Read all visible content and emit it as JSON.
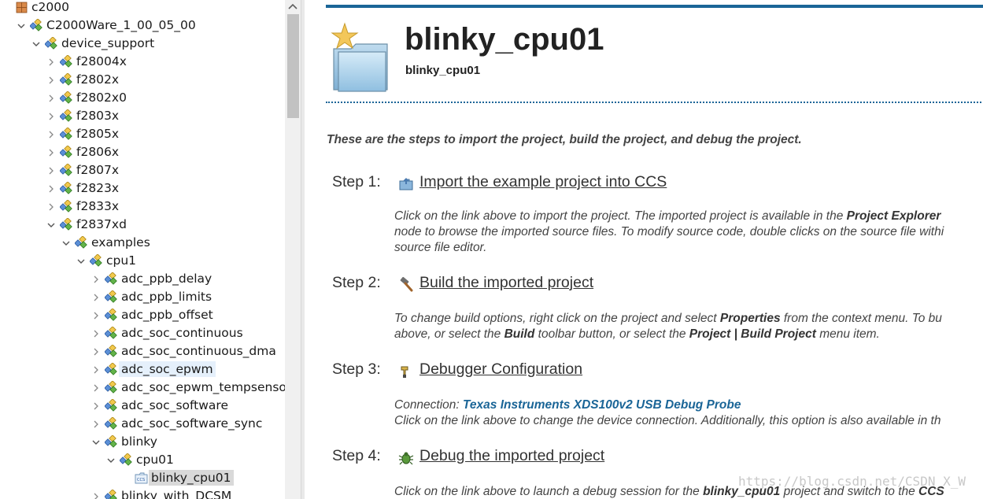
{
  "tree": {
    "items": [
      {
        "label": "c2000",
        "depth": 0,
        "expanded": null,
        "icon": "project-root-icon"
      },
      {
        "label": "C2000Ware_1_00_05_00",
        "depth": 1,
        "expanded": true,
        "icon": "package-icon"
      },
      {
        "label": "device_support",
        "depth": 2,
        "expanded": true,
        "icon": "package-icon"
      },
      {
        "label": "f28004x",
        "depth": 3,
        "expanded": false,
        "icon": "package-icon"
      },
      {
        "label": "f2802x",
        "depth": 3,
        "expanded": false,
        "icon": "package-icon"
      },
      {
        "label": "f2802x0",
        "depth": 3,
        "expanded": false,
        "icon": "package-icon"
      },
      {
        "label": "f2803x",
        "depth": 3,
        "expanded": false,
        "icon": "package-icon"
      },
      {
        "label": "f2805x",
        "depth": 3,
        "expanded": false,
        "icon": "package-icon"
      },
      {
        "label": "f2806x",
        "depth": 3,
        "expanded": false,
        "icon": "package-icon"
      },
      {
        "label": "f2807x",
        "depth": 3,
        "expanded": false,
        "icon": "package-icon"
      },
      {
        "label": "f2823x",
        "depth": 3,
        "expanded": false,
        "icon": "package-icon"
      },
      {
        "label": "f2833x",
        "depth": 3,
        "expanded": false,
        "icon": "package-icon"
      },
      {
        "label": "f2837xd",
        "depth": 3,
        "expanded": true,
        "icon": "package-icon"
      },
      {
        "label": "examples",
        "depth": 4,
        "expanded": true,
        "icon": "package-icon"
      },
      {
        "label": "cpu1",
        "depth": 5,
        "expanded": true,
        "icon": "package-icon"
      },
      {
        "label": "adc_ppb_delay",
        "depth": 6,
        "expanded": false,
        "icon": "package-icon"
      },
      {
        "label": "adc_ppb_limits",
        "depth": 6,
        "expanded": false,
        "icon": "package-icon"
      },
      {
        "label": "adc_ppb_offset",
        "depth": 6,
        "expanded": false,
        "icon": "package-icon"
      },
      {
        "label": "adc_soc_continuous",
        "depth": 6,
        "expanded": false,
        "icon": "package-icon"
      },
      {
        "label": "adc_soc_continuous_dma",
        "depth": 6,
        "expanded": false,
        "icon": "package-icon"
      },
      {
        "label": "adc_soc_epwm",
        "depth": 6,
        "expanded": false,
        "icon": "package-icon",
        "highlight": "soft"
      },
      {
        "label": "adc_soc_epwm_tempsensor",
        "depth": 6,
        "expanded": false,
        "icon": "package-icon"
      },
      {
        "label": "adc_soc_software",
        "depth": 6,
        "expanded": false,
        "icon": "package-icon"
      },
      {
        "label": "adc_soc_software_sync",
        "depth": 6,
        "expanded": false,
        "icon": "package-icon"
      },
      {
        "label": "blinky",
        "depth": 6,
        "expanded": true,
        "icon": "package-icon"
      },
      {
        "label": "cpu01",
        "depth": 7,
        "expanded": true,
        "icon": "package-icon"
      },
      {
        "label": "blinky_cpu01",
        "depth": 8,
        "expanded": null,
        "icon": "ccs-project-icon",
        "highlight": "hard"
      },
      {
        "label": "blinky_with_DCSM",
        "depth": 6,
        "expanded": false,
        "icon": "package-icon"
      }
    ]
  },
  "header": {
    "title": "blinky_cpu01",
    "subtitle": "blinky_cpu01"
  },
  "intro": "These are the steps to import the project, build the project, and debug the project.",
  "steps": [
    {
      "label": "Step 1:",
      "link": "Import the example project into CCS",
      "icon": "import-project-icon",
      "desc": {
        "l1a": "Click on the link above to import the project. The imported project is available in the ",
        "l1b": "Project Explorer",
        "l2": "node to browse the imported source files. To modify source code, double clicks on the source file withi",
        "l3": "source file editor."
      }
    },
    {
      "label": "Step 2:",
      "link": "Build the imported project",
      "icon": "hammer-icon",
      "desc": {
        "l1a": "To change build options, right click on the project and select ",
        "l1b": "Properties",
        "l1c": " from the context menu. To bu",
        "l2a": "above, or select the ",
        "l2b": "Build",
        "l2c": " toolbar button, or select the ",
        "l2d": "Project | Build Project",
        "l2e": " menu item."
      }
    },
    {
      "label": "Step 3:",
      "link": "Debugger Configuration",
      "icon": "debugger-config-icon",
      "desc": {
        "l1a": "Connection: ",
        "l1b": "Texas Instruments XDS100v2 USB Debug Probe",
        "l2": "Click on the link above to change the device connection. Additionally, this option is also available in th"
      }
    },
    {
      "label": "Step 4:",
      "link": "Debug the imported project",
      "icon": "bug-icon",
      "desc": {
        "l1a": "Click on the link above to launch a debug session for the ",
        "l1b": "blinky_cpu01",
        "l1c": " project and switch to the ",
        "l1d": "CCS"
      }
    }
  ],
  "watermark": "https://blog.csdn.net/CSDN_X_W",
  "colors": {
    "accent": "#1a6597",
    "selection_soft": "#e5f0fb",
    "selection_hard": "#d9d9d9"
  }
}
